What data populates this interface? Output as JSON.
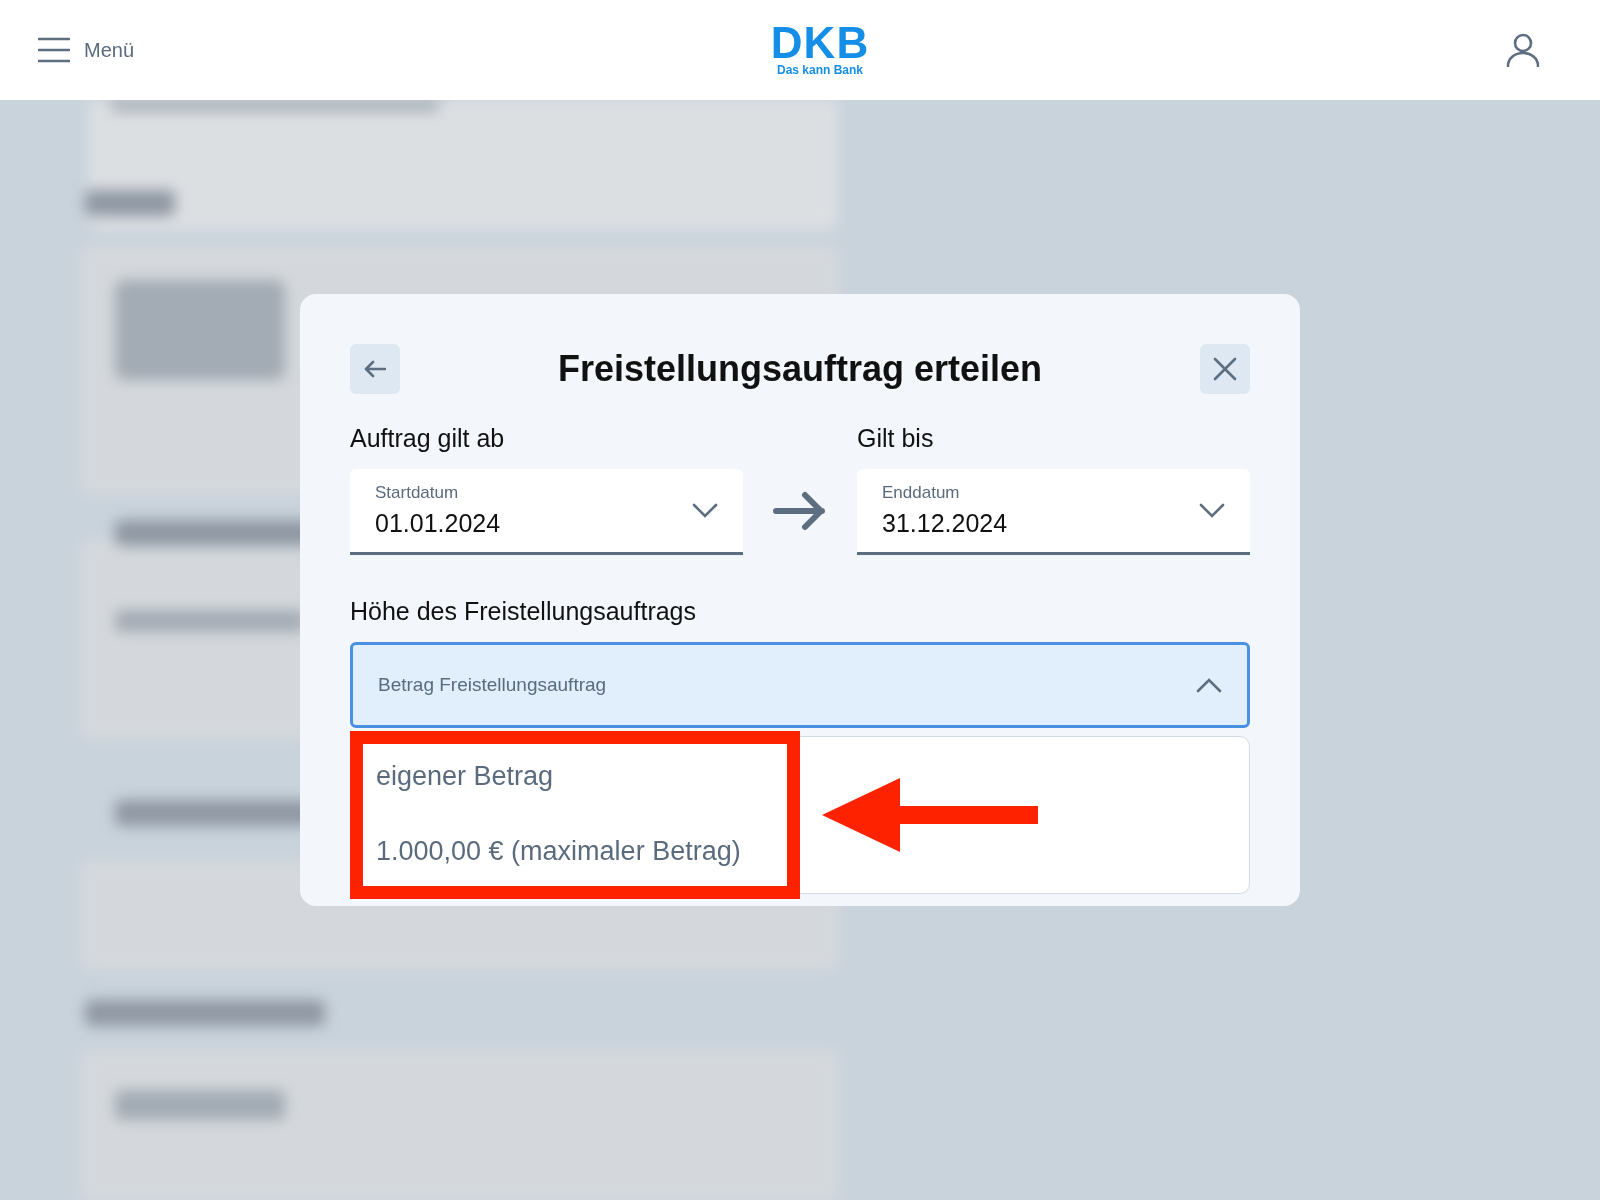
{
  "header": {
    "menu_label": "Menü",
    "logo": {
      "name": "DKB",
      "tagline": "Das kann Bank"
    }
  },
  "dialog": {
    "title": "Freistellungsauftrag erteilen",
    "start": {
      "heading": "Auftrag gilt ab",
      "label": "Startdatum",
      "value": "01.01.2024"
    },
    "end": {
      "heading": "Gilt bis",
      "label": "Enddatum",
      "value": "31.12.2024"
    },
    "amount": {
      "heading": "Höhe des Freistellungsauftrags",
      "label": "Betrag Freistellungsauftrag",
      "expanded": true,
      "options": [
        {
          "label": "eigener Betrag"
        },
        {
          "label": "1.000,00 € (maximaler Betrag)"
        }
      ]
    }
  }
}
